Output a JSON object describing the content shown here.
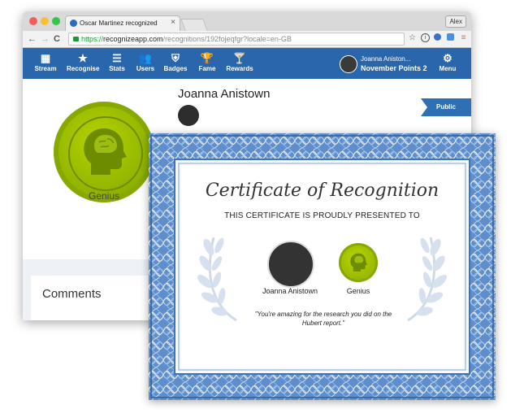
{
  "browser": {
    "tab_title": "Oscar Martinez recognized",
    "tab_close": "×",
    "user_chip": "Alex",
    "nav_back": "←",
    "nav_forward": "→",
    "nav_reload": "C",
    "url_scheme": "https://",
    "url_host": "recognizeapp.com",
    "url_path": "/recognitions/192fojeqfgr?locale=en-GB"
  },
  "app_nav": {
    "items": [
      {
        "label": "Stream",
        "icon": "grid-icon",
        "glyph": "▦"
      },
      {
        "label": "Recognise",
        "icon": "star-icon",
        "glyph": "★"
      },
      {
        "label": "Stats",
        "icon": "list-icon",
        "glyph": "☰"
      },
      {
        "label": "Users",
        "icon": "users-icon",
        "glyph": "👥"
      },
      {
        "label": "Badges",
        "icon": "shield-icon",
        "glyph": "⛨"
      },
      {
        "label": "Fame",
        "icon": "trophy-icon",
        "glyph": "🏆"
      },
      {
        "label": "Rewards",
        "icon": "cocktail-icon",
        "glyph": "🍸"
      }
    ],
    "me_name": "Joanna Aniston...",
    "me_points": "November Points 2",
    "menu_label": "Menu",
    "menu_glyph": "⚙"
  },
  "recognition": {
    "badge_name": "Genius",
    "recipient_name": "Joanna Anistown",
    "visibility": "Public",
    "comments_label": "Comments"
  },
  "certificate": {
    "title": "Certificate of Recognition",
    "subtitle": "THIS CERTIFICATE IS PROUDLY PRESENTED TO",
    "recipient_name": "Joanna Anistown",
    "badge_name": "Genius",
    "quote": "\"You're amazing for the research you did on the Hubert report.\""
  },
  "colors": {
    "nav_blue": "#2a66ac",
    "badge_green": "#95b800",
    "certificate_blue": "#3d74b8"
  }
}
